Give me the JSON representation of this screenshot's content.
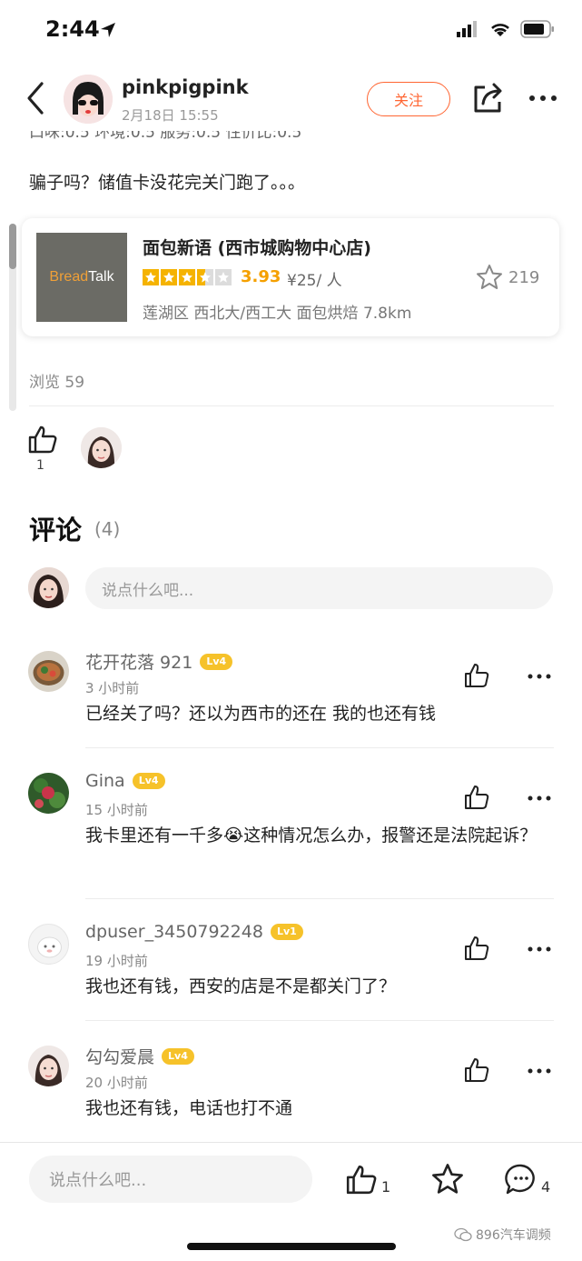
{
  "status_bar": {
    "time": "2:44"
  },
  "author": {
    "name": "pinkpigpink",
    "date": "2月18日  15:55",
    "follow_label": "关注"
  },
  "review": {
    "cut_line": "口味:0.5   环境:0.5   服务:0.5   性价比:0.5",
    "text": "骗子吗？储值卡没花完关门跑了。。。"
  },
  "shop": {
    "logo_text_a": "Bread",
    "logo_text_b": "Talk",
    "name": "面包新语 (西市城购物中心店)",
    "rating": "3.93",
    "rating_stars": 3.5,
    "price": "¥25/ 人",
    "favorites": "219",
    "meta": "莲湖区 西北大/西工大 面包烘焙  7.8km"
  },
  "views": "浏览 59",
  "like": {
    "count": "1"
  },
  "comments_section": {
    "title": "评论",
    "count": "(4)",
    "input_placeholder": "说点什么吧..."
  },
  "comments": [
    {
      "user": "花开花落 921",
      "level": "Lv4",
      "time": "3 小时前",
      "text": "已经关了吗？还以为西市的还在 我的也还有钱"
    },
    {
      "user": "Gina",
      "level": "Lv4",
      "time": "15 小时前",
      "text": "我卡里还有一千多😭这种情况怎么办，报警还是法院起诉？"
    },
    {
      "user": "dpuser_3450792248",
      "level": "Lv1",
      "time": "19 小时前",
      "text": "我也还有钱，西安的店是不是都关门了？"
    },
    {
      "user": "勾勾爱晨",
      "level": "Lv4",
      "time": "20 小时前",
      "text": "我也还有钱，电话也打不通"
    }
  ],
  "bottom_bar": {
    "input_placeholder": "说点什么吧...",
    "like_count": "1",
    "comment_count": "4"
  },
  "watermark": "896汽车调频",
  "colors": {
    "accent": "#ff6633",
    "star": "#f5b301",
    "level_badge": "#f6c22a"
  }
}
